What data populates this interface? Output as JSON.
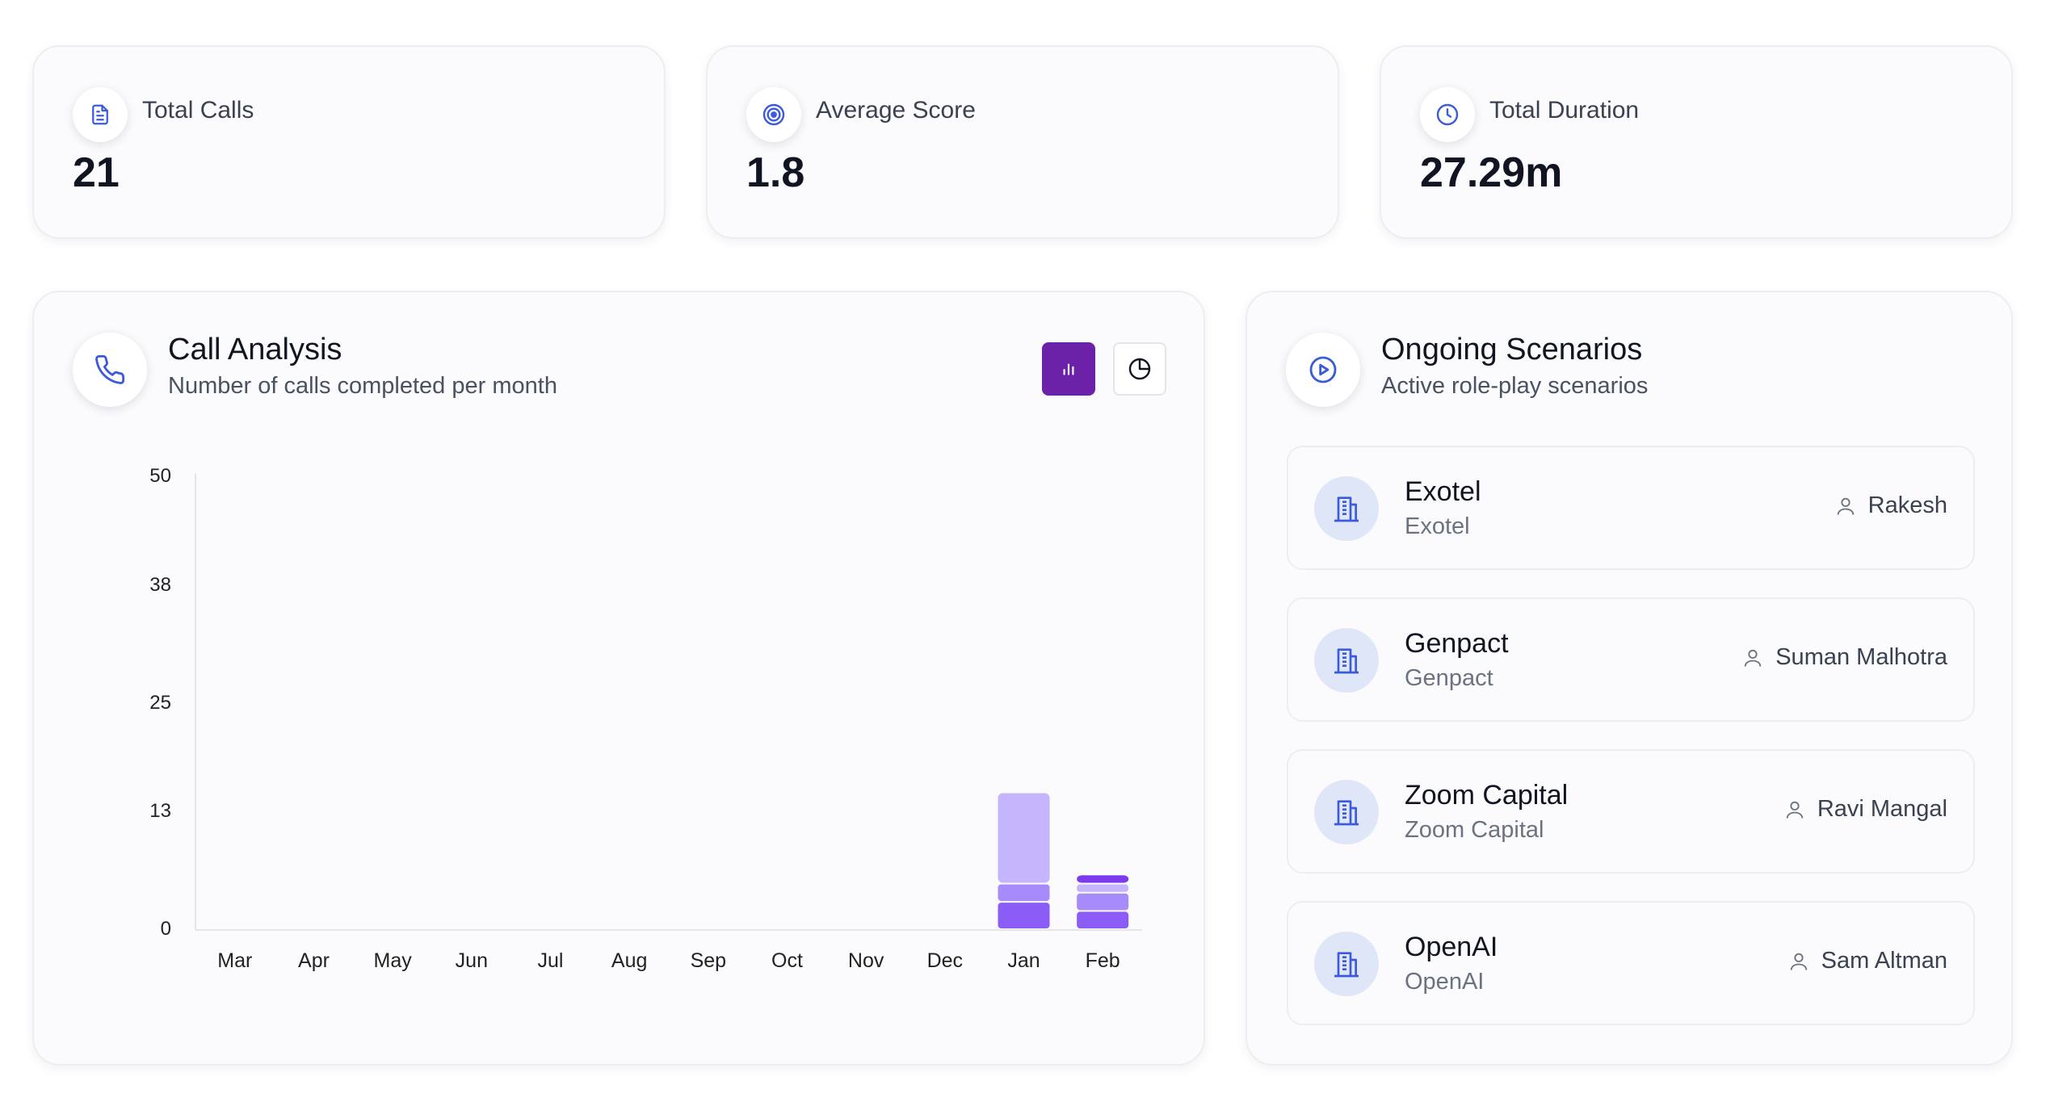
{
  "stats": [
    {
      "label": "Total Calls",
      "value": "21",
      "icon": "document-icon"
    },
    {
      "label": "Average Score",
      "value": "1.8",
      "icon": "target-icon"
    },
    {
      "label": "Total Duration",
      "value": "27.29m",
      "icon": "clock-icon"
    }
  ],
  "call_analysis": {
    "title": "Call Analysis",
    "subtitle": "Number of calls completed per month",
    "view_toggle": {
      "active": "bar-chart",
      "options": [
        "bar-chart",
        "pie-chart"
      ]
    },
    "accent_color": "#6b21a8"
  },
  "chart_data": {
    "type": "bar",
    "title": "",
    "xlabel": "",
    "ylabel": "",
    "categories": [
      "Mar",
      "Apr",
      "May",
      "Jun",
      "Jul",
      "Aug",
      "Sep",
      "Oct",
      "Nov",
      "Dec",
      "Jan",
      "Feb"
    ],
    "y_ticks": [
      "50",
      "38",
      "25",
      "13",
      "0"
    ],
    "ylim": [
      0,
      50
    ],
    "grid": false,
    "series": [
      {
        "values": [
          0,
          0,
          0,
          0,
          0,
          0,
          0,
          0,
          0,
          0,
          3,
          2
        ],
        "color": "#8b5cf6"
      },
      {
        "values": [
          0,
          0,
          0,
          0,
          0,
          0,
          0,
          0,
          0,
          0,
          2,
          2
        ],
        "color": "#a78bfa"
      },
      {
        "values": [
          0,
          0,
          0,
          0,
          0,
          0,
          0,
          0,
          0,
          0,
          10,
          1
        ],
        "color": "#c4b5fd"
      },
      {
        "values": [
          0,
          0,
          0,
          0,
          0,
          0,
          0,
          0,
          0,
          0,
          0,
          1
        ],
        "color": "#7c3aed"
      }
    ]
  },
  "scenarios": {
    "title": "Ongoing Scenarios",
    "subtitle": "Active role-play scenarios",
    "items": [
      {
        "name": "Exotel",
        "company": "Exotel",
        "person": "Rakesh"
      },
      {
        "name": "Genpact",
        "company": "Genpact",
        "person": "Suman Malhotra"
      },
      {
        "name": "Zoom Capital",
        "company": "Zoom Capital",
        "person": "Ravi Mangal"
      },
      {
        "name": "OpenAI",
        "company": "OpenAI",
        "person": "Sam Altman"
      }
    ]
  }
}
